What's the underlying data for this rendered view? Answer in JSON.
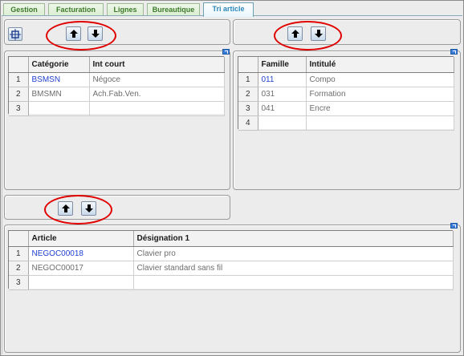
{
  "tabs": [
    {
      "label": "Gestion",
      "active": false
    },
    {
      "label": "Facturation",
      "active": false
    },
    {
      "label": "Lignes",
      "active": false
    },
    {
      "label": "Bureautique",
      "active": false
    },
    {
      "label": "Tri article",
      "active": true
    }
  ],
  "colors": {
    "highlight_circle": "#e00000",
    "link_text": "#1f3fd0",
    "tab_active": "#2b89b8",
    "tab_inactive": "#3c7a2a"
  },
  "icons": [
    "pattern-toggle-icon",
    "arrow-up-icon",
    "arrow-down-icon",
    "expand-corner-icon"
  ],
  "category_grid": {
    "columns": [
      "Catégorie",
      "Int court"
    ],
    "rows": [
      {
        "n": "1",
        "code": "BSMSN",
        "label": "Négoce"
      },
      {
        "n": "2",
        "code": "BMSMN",
        "label": "Ach.Fab.Ven."
      },
      {
        "n": "3",
        "code": "",
        "label": ""
      }
    ]
  },
  "family_grid": {
    "columns": [
      "Famille",
      "Intitulé"
    ],
    "rows": [
      {
        "n": "1",
        "code": "011",
        "label": "Compo"
      },
      {
        "n": "2",
        "code": "031",
        "label": "Formation"
      },
      {
        "n": "3",
        "code": "041",
        "label": "Encre"
      },
      {
        "n": "4",
        "code": "",
        "label": ""
      }
    ]
  },
  "article_grid": {
    "columns": [
      "Article",
      "Désignation 1"
    ],
    "rows": [
      {
        "n": "1",
        "code": "NEGOC00018",
        "label": "Clavier pro"
      },
      {
        "n": "2",
        "code": "NEGOC00017",
        "label": "Clavier standard sans fil"
      },
      {
        "n": "3",
        "code": "",
        "label": ""
      }
    ]
  }
}
